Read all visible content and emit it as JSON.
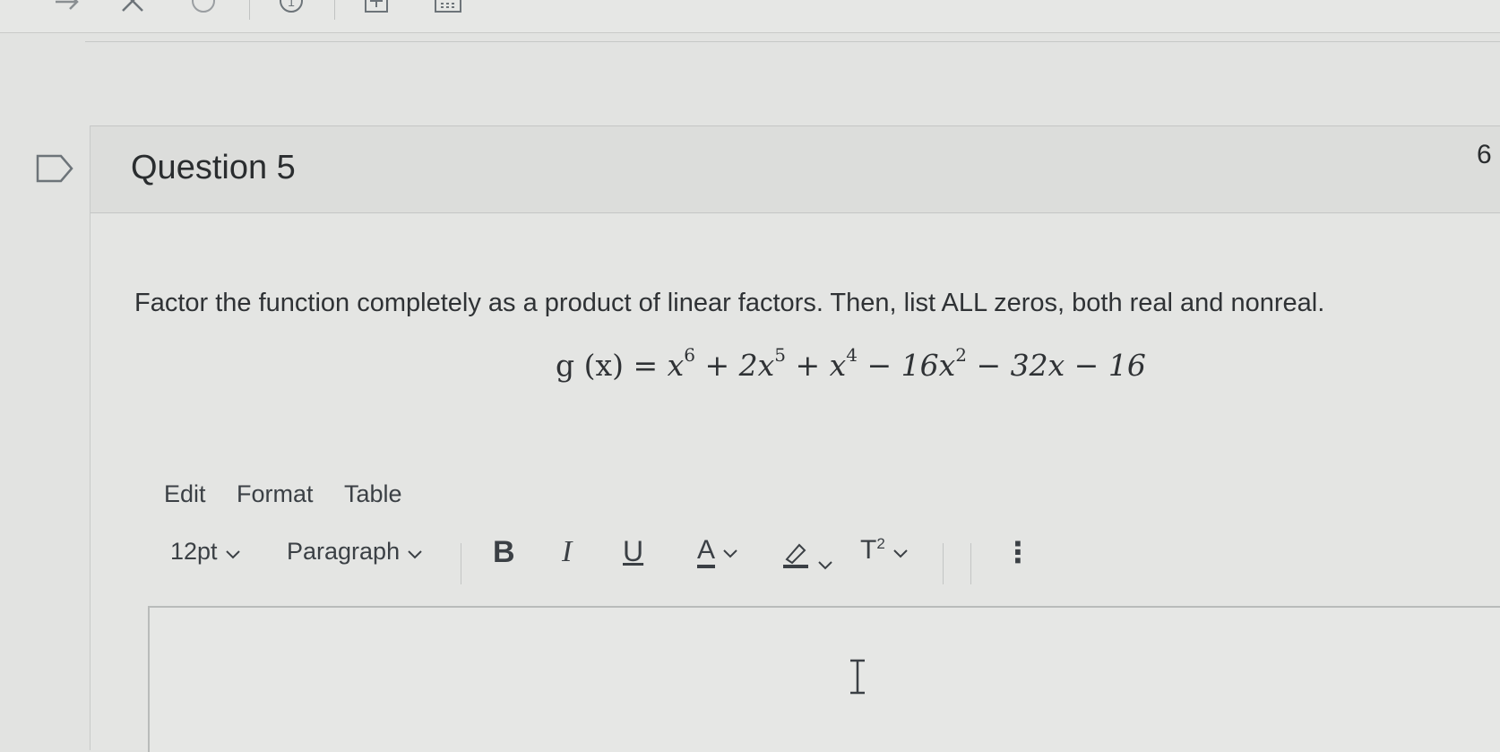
{
  "question": {
    "title": "Question 5",
    "points": "6",
    "prompt": "Factor the function completely as a product of linear factors. Then, list ALL zeros, both real and nonreal.",
    "equation": {
      "lhs": "g (x) =",
      "terms": [
        {
          "text": "x",
          "sup": "6"
        },
        {
          "text": "+ 2x",
          "sup": "5"
        },
        {
          "text": "+ x",
          "sup": "4"
        },
        {
          "text": "− 16x",
          "sup": "2"
        },
        {
          "text": "− 32x − 16",
          "sup": ""
        }
      ]
    }
  },
  "editor": {
    "menu": {
      "edit": "Edit",
      "format": "Format",
      "table": "Table"
    },
    "toolbar": {
      "font_size": "12pt",
      "block_format": "Paragraph",
      "bold": "B",
      "italic": "I",
      "underline": "U",
      "text_color": "A",
      "superscript": "T",
      "superscript_mark": "2",
      "more": "⋮"
    }
  },
  "top_toolbar": {
    "icons": [
      "redo-icon",
      "close-icon",
      "circle-icon",
      "info-icon",
      "add-box-icon",
      "calendar-icon"
    ],
    "info_label": "1"
  },
  "colors": {
    "background": "#e2e3e1",
    "text": "#2f3235",
    "icon": "#3b4045"
  }
}
